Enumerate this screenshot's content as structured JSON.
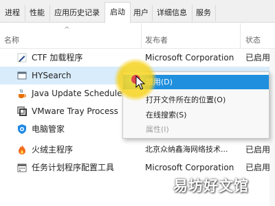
{
  "tabs": [
    {
      "label": "进程"
    },
    {
      "label": "性能"
    },
    {
      "label": "应用历史记录"
    },
    {
      "label": "启动",
      "active": true
    },
    {
      "label": "用户"
    },
    {
      "label": "详细信息"
    },
    {
      "label": "服务"
    }
  ],
  "columns": {
    "name": "名称",
    "publisher": "发布者",
    "status": "状态"
  },
  "rows": [
    {
      "name": "CTF 加载程序",
      "publisher": "Microsoft Corporation",
      "status": "已启用",
      "icon": "pen-icon"
    },
    {
      "name": "HYSearch",
      "publisher": "",
      "status": "",
      "icon": "window-icon",
      "selected": true
    },
    {
      "name": "Java Update Scheduler",
      "publisher": "",
      "status": "",
      "icon": "java-icon"
    },
    {
      "name": "VMware Tray Process",
      "publisher": "",
      "status": "",
      "icon": "vmware-icon"
    },
    {
      "name": "电脑管家",
      "publisher": "",
      "status": "",
      "icon": "shield-icon"
    },
    {
      "name": "火绒主程序",
      "publisher": "北京众纳鑫海网络技术...",
      "status": "已启用",
      "icon": "flame-icon"
    },
    {
      "name": "任务计划程序配置工具",
      "publisher": "Microsoft Corporation",
      "status": "已启用",
      "icon": "calendar-icon"
    }
  ],
  "context_menu": {
    "items": [
      {
        "label": "禁用(D)",
        "highlight": true
      },
      {
        "label": "打开文件所在的位置(O)"
      },
      {
        "label": "在线搜索(S)"
      },
      {
        "label": "属性(I)",
        "disabled": true
      }
    ]
  },
  "watermark": "易坊好文馆",
  "colors": {
    "selected_row": "#d9ecfb",
    "menu_highlight": "#1f8fde",
    "cursor_glow": "#f7d21e"
  }
}
